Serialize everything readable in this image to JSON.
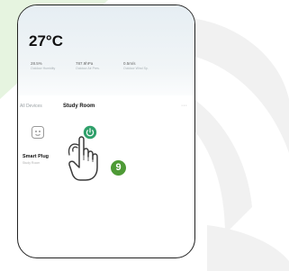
{
  "weather": {
    "temperature": "27°C",
    "stats": [
      {
        "value": "28.5%",
        "label": "Outdoor Humidity"
      },
      {
        "value": "787.9hPa",
        "label": "Outdoor Air Pres."
      },
      {
        "value": "0.5m/s",
        "label": "Outdoor Wind Sp."
      }
    ]
  },
  "tabs": {
    "items": [
      "All Devices",
      "Study Room"
    ],
    "active_index": 1,
    "more": "···"
  },
  "devices": [
    {
      "name": "Smart Plug",
      "status": "Study Room",
      "icon": "plug-icon"
    },
    {
      "name": "",
      "status": "",
      "icon": "power-icon"
    }
  ],
  "step_badge": "9",
  "colors": {
    "accent_green": "#2fa06a",
    "badge_green": "#4e9a36",
    "swoosh_green": "#e6f4e0",
    "swoosh_gray": "#f1f1f1"
  }
}
